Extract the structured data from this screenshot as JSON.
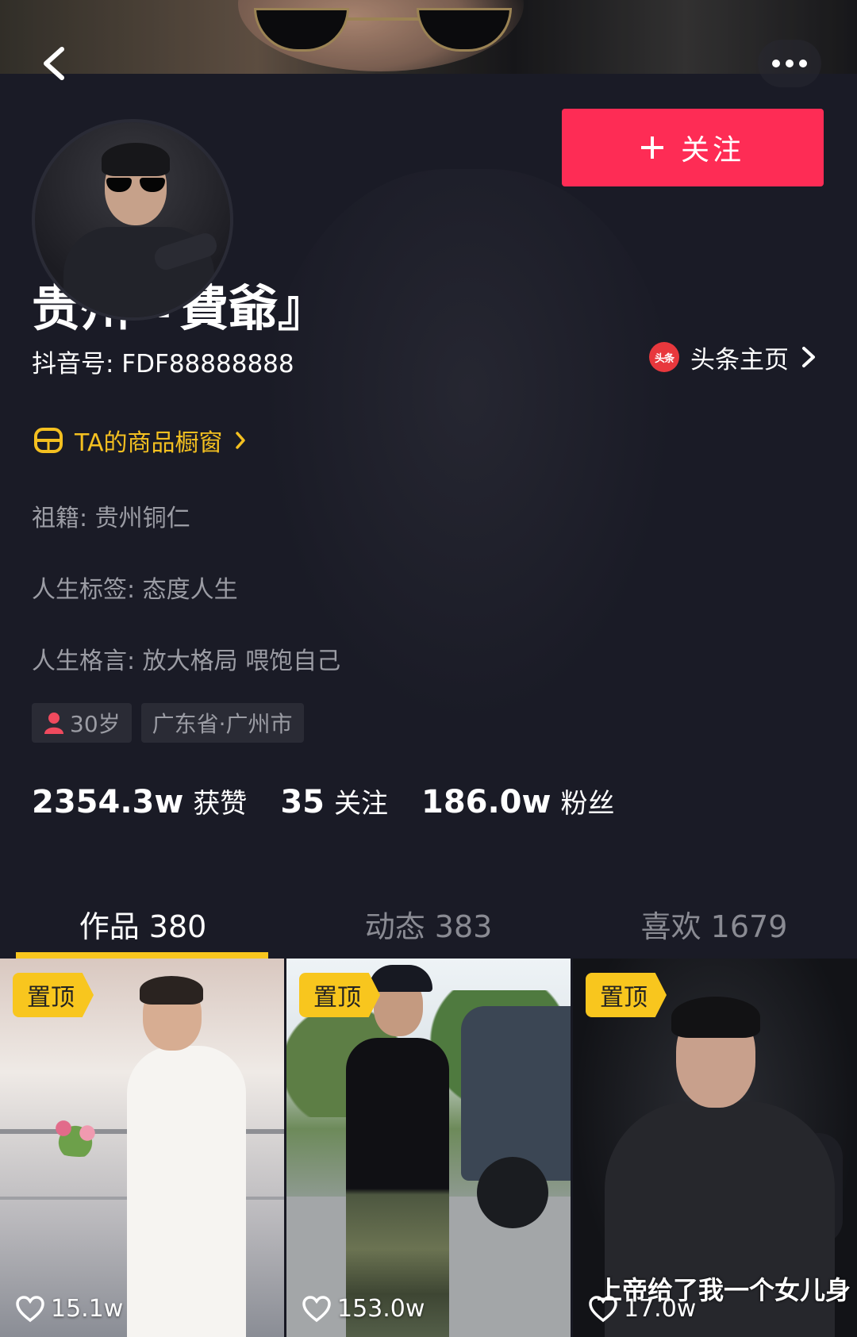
{
  "header": {
    "back_icon": "chevron-left-icon",
    "more_icon": "more-dots-icon"
  },
  "profile": {
    "name": "贵州『費爺』",
    "douyin_id": "抖音号: FDF88888888",
    "follow_label": "关注",
    "follow_color": "#fe2c55",
    "toutiao": {
      "icon_text": "头条",
      "label": "头条主页"
    },
    "shop_label": "TA的商品橱窗",
    "shop_color": "#f4c020",
    "bio": [
      "祖籍: 贵州铜仁",
      "人生标签: 态度人生",
      "人生格言: 放大格局 喂饱自己"
    ],
    "tags": {
      "age": "30岁",
      "location": "广东省·广州市"
    },
    "stats": {
      "likes": {
        "value": "2354.3w",
        "label": "获赞"
      },
      "following": {
        "value": "35",
        "label": "关注"
      },
      "followers": {
        "value": "186.0w",
        "label": "粉丝"
      }
    }
  },
  "tabs": [
    {
      "label": "作品 380",
      "active": true
    },
    {
      "label": "动态 383",
      "active": false
    },
    {
      "label": "喜欢 1679",
      "active": false
    }
  ],
  "tab_accent": "#f8c61e",
  "videos": [
    {
      "pin": "置顶",
      "likes": "15.1w",
      "caption": ""
    },
    {
      "pin": "置顶",
      "likes": "153.0w",
      "caption": ""
    },
    {
      "pin": "置顶",
      "likes": "17.0w",
      "caption": "上帝给了我一个女儿身"
    }
  ]
}
